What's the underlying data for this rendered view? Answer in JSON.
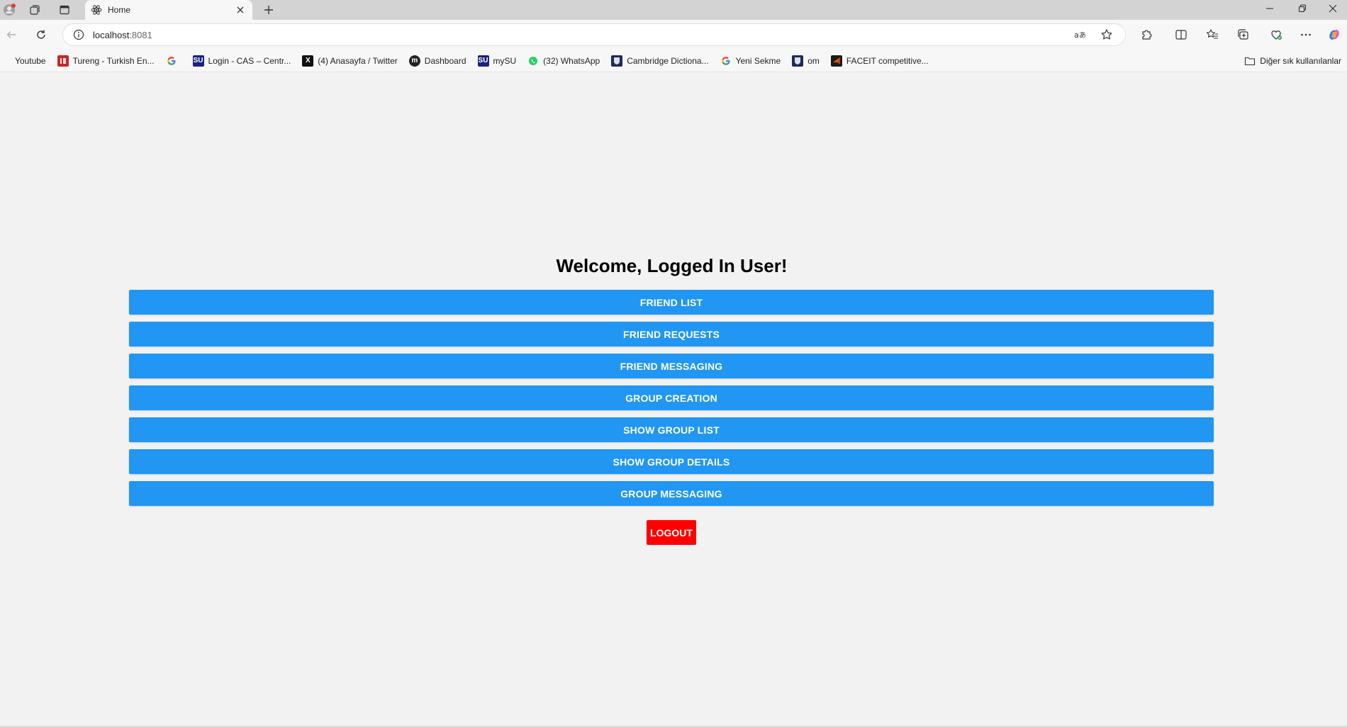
{
  "browser": {
    "tab_title": "Home",
    "url_host": "localhost",
    "url_port": ":8081",
    "colors": {
      "tabstrip": "#d3d3d3",
      "toolbar": "#f7f7f7"
    }
  },
  "bookmarks": {
    "items": [
      {
        "label": "Youtube",
        "icon": "youtube-icon"
      },
      {
        "label": "Tureng - Turkish En...",
        "icon": "tureng-icon"
      },
      {
        "label": "",
        "icon": "google-icon"
      },
      {
        "label": "Login - CAS – Centr...",
        "icon": "su-icon"
      },
      {
        "label": "(4) Anasayfa / Twitter",
        "icon": "x-icon"
      },
      {
        "label": "Dashboard",
        "icon": "dashboard-icon"
      },
      {
        "label": "mySU",
        "icon": "su-icon"
      },
      {
        "label": "(32) WhatsApp",
        "icon": "whatsapp-icon"
      },
      {
        "label": "Cambridge Dictiona...",
        "icon": "cambridge-icon"
      },
      {
        "label": "Yeni Sekme",
        "icon": "google-icon"
      },
      {
        "label": "om",
        "icon": "om-icon"
      },
      {
        "label": "FACEIT competitive...",
        "icon": "faceit-icon"
      }
    ],
    "other_label": "Diğer sık kullanılanlar"
  },
  "page": {
    "welcome": "Welcome, Logged In User!",
    "buttons": [
      "FRIEND LIST",
      "FRIEND REQUESTS",
      "FRIEND MESSAGING",
      "GROUP CREATION",
      "SHOW GROUP LIST",
      "SHOW GROUP DETAILS",
      "GROUP MESSAGING"
    ],
    "logout": "LOGOUT",
    "colors": {
      "primary": "#2196f3",
      "danger": "#ff0000",
      "background": "#f2f2f2"
    }
  }
}
